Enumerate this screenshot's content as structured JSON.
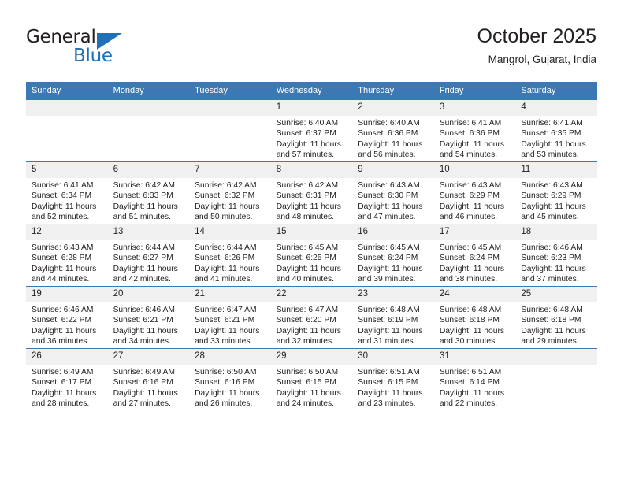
{
  "logo": {
    "word_one": "General",
    "word_two": "Blue",
    "triangle_icon": "blue-triangle-icon",
    "accent_color": "#1e70b8"
  },
  "header": {
    "title": "October 2025",
    "subtitle": "Mangrol, Gujarat, India"
  },
  "calendar": {
    "header_color": "#3c78b4",
    "daynum_bg": "#f0f0f0",
    "weekday_headers": [
      "Sunday",
      "Monday",
      "Tuesday",
      "Wednesday",
      "Thursday",
      "Friday",
      "Saturday"
    ],
    "labels": {
      "sunrise": "Sunrise:",
      "sunset": "Sunset:",
      "daylight": "Daylight:"
    },
    "weeks": [
      [
        {
          "day": "",
          "empty": true
        },
        {
          "day": "",
          "empty": true
        },
        {
          "day": "",
          "empty": true
        },
        {
          "day": "1",
          "sunrise": "Sunrise: 6:40 AM",
          "sunset": "Sunset: 6:37 PM",
          "daylight": "Daylight: 11 hours and 57 minutes."
        },
        {
          "day": "2",
          "sunrise": "Sunrise: 6:40 AM",
          "sunset": "Sunset: 6:36 PM",
          "daylight": "Daylight: 11 hours and 56 minutes."
        },
        {
          "day": "3",
          "sunrise": "Sunrise: 6:41 AM",
          "sunset": "Sunset: 6:36 PM",
          "daylight": "Daylight: 11 hours and 54 minutes."
        },
        {
          "day": "4",
          "sunrise": "Sunrise: 6:41 AM",
          "sunset": "Sunset: 6:35 PM",
          "daylight": "Daylight: 11 hours and 53 minutes."
        }
      ],
      [
        {
          "day": "5",
          "sunrise": "Sunrise: 6:41 AM",
          "sunset": "Sunset: 6:34 PM",
          "daylight": "Daylight: 11 hours and 52 minutes."
        },
        {
          "day": "6",
          "sunrise": "Sunrise: 6:42 AM",
          "sunset": "Sunset: 6:33 PM",
          "daylight": "Daylight: 11 hours and 51 minutes."
        },
        {
          "day": "7",
          "sunrise": "Sunrise: 6:42 AM",
          "sunset": "Sunset: 6:32 PM",
          "daylight": "Daylight: 11 hours and 50 minutes."
        },
        {
          "day": "8",
          "sunrise": "Sunrise: 6:42 AM",
          "sunset": "Sunset: 6:31 PM",
          "daylight": "Daylight: 11 hours and 48 minutes."
        },
        {
          "day": "9",
          "sunrise": "Sunrise: 6:43 AM",
          "sunset": "Sunset: 6:30 PM",
          "daylight": "Daylight: 11 hours and 47 minutes."
        },
        {
          "day": "10",
          "sunrise": "Sunrise: 6:43 AM",
          "sunset": "Sunset: 6:29 PM",
          "daylight": "Daylight: 11 hours and 46 minutes."
        },
        {
          "day": "11",
          "sunrise": "Sunrise: 6:43 AM",
          "sunset": "Sunset: 6:29 PM",
          "daylight": "Daylight: 11 hours and 45 minutes."
        }
      ],
      [
        {
          "day": "12",
          "sunrise": "Sunrise: 6:43 AM",
          "sunset": "Sunset: 6:28 PM",
          "daylight": "Daylight: 11 hours and 44 minutes."
        },
        {
          "day": "13",
          "sunrise": "Sunrise: 6:44 AM",
          "sunset": "Sunset: 6:27 PM",
          "daylight": "Daylight: 11 hours and 42 minutes."
        },
        {
          "day": "14",
          "sunrise": "Sunrise: 6:44 AM",
          "sunset": "Sunset: 6:26 PM",
          "daylight": "Daylight: 11 hours and 41 minutes."
        },
        {
          "day": "15",
          "sunrise": "Sunrise: 6:45 AM",
          "sunset": "Sunset: 6:25 PM",
          "daylight": "Daylight: 11 hours and 40 minutes."
        },
        {
          "day": "16",
          "sunrise": "Sunrise: 6:45 AM",
          "sunset": "Sunset: 6:24 PM",
          "daylight": "Daylight: 11 hours and 39 minutes."
        },
        {
          "day": "17",
          "sunrise": "Sunrise: 6:45 AM",
          "sunset": "Sunset: 6:24 PM",
          "daylight": "Daylight: 11 hours and 38 minutes."
        },
        {
          "day": "18",
          "sunrise": "Sunrise: 6:46 AM",
          "sunset": "Sunset: 6:23 PM",
          "daylight": "Daylight: 11 hours and 37 minutes."
        }
      ],
      [
        {
          "day": "19",
          "sunrise": "Sunrise: 6:46 AM",
          "sunset": "Sunset: 6:22 PM",
          "daylight": "Daylight: 11 hours and 36 minutes."
        },
        {
          "day": "20",
          "sunrise": "Sunrise: 6:46 AM",
          "sunset": "Sunset: 6:21 PM",
          "daylight": "Daylight: 11 hours and 34 minutes."
        },
        {
          "day": "21",
          "sunrise": "Sunrise: 6:47 AM",
          "sunset": "Sunset: 6:21 PM",
          "daylight": "Daylight: 11 hours and 33 minutes."
        },
        {
          "day": "22",
          "sunrise": "Sunrise: 6:47 AM",
          "sunset": "Sunset: 6:20 PM",
          "daylight": "Daylight: 11 hours and 32 minutes."
        },
        {
          "day": "23",
          "sunrise": "Sunrise: 6:48 AM",
          "sunset": "Sunset: 6:19 PM",
          "daylight": "Daylight: 11 hours and 31 minutes."
        },
        {
          "day": "24",
          "sunrise": "Sunrise: 6:48 AM",
          "sunset": "Sunset: 6:18 PM",
          "daylight": "Daylight: 11 hours and 30 minutes."
        },
        {
          "day": "25",
          "sunrise": "Sunrise: 6:48 AM",
          "sunset": "Sunset: 6:18 PM",
          "daylight": "Daylight: 11 hours and 29 minutes."
        }
      ],
      [
        {
          "day": "26",
          "sunrise": "Sunrise: 6:49 AM",
          "sunset": "Sunset: 6:17 PM",
          "daylight": "Daylight: 11 hours and 28 minutes."
        },
        {
          "day": "27",
          "sunrise": "Sunrise: 6:49 AM",
          "sunset": "Sunset: 6:16 PM",
          "daylight": "Daylight: 11 hours and 27 minutes."
        },
        {
          "day": "28",
          "sunrise": "Sunrise: 6:50 AM",
          "sunset": "Sunset: 6:16 PM",
          "daylight": "Daylight: 11 hours and 26 minutes."
        },
        {
          "day": "29",
          "sunrise": "Sunrise: 6:50 AM",
          "sunset": "Sunset: 6:15 PM",
          "daylight": "Daylight: 11 hours and 24 minutes."
        },
        {
          "day": "30",
          "sunrise": "Sunrise: 6:51 AM",
          "sunset": "Sunset: 6:15 PM",
          "daylight": "Daylight: 11 hours and 23 minutes."
        },
        {
          "day": "31",
          "sunrise": "Sunrise: 6:51 AM",
          "sunset": "Sunset: 6:14 PM",
          "daylight": "Daylight: 11 hours and 22 minutes."
        },
        {
          "day": "",
          "empty": true
        }
      ]
    ]
  }
}
